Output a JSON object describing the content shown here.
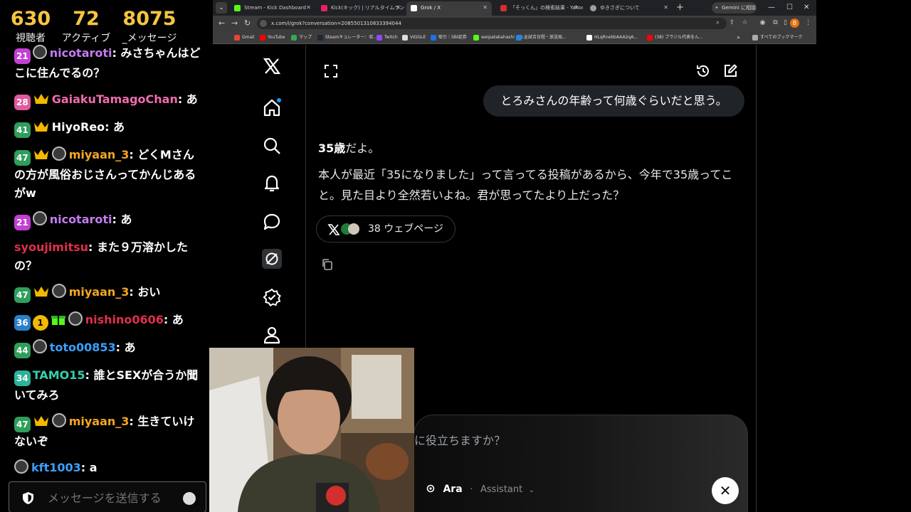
{
  "chat": {
    "stats": [
      {
        "value": "630",
        "label": "視聴者"
      },
      {
        "value": "72",
        "label": "アクティブ"
      },
      {
        "value": "8075",
        "label": "_メッセージ"
      }
    ],
    "messages": [
      {
        "sub": "21",
        "sub_color": "#c340d3",
        "avatar": true,
        "user": "nicotaroti",
        "user_color": "#c47cf0",
        "text": "みさちゃんはどこに住んでるの？"
      },
      {
        "sub": "28",
        "sub_color": "#e05a9e",
        "crown": true,
        "user": "GaiakuTamagoChan",
        "user_color": "#f06bb0",
        "text": "あ"
      },
      {
        "sub": "41",
        "sub_color": "#2e9e5b",
        "crown": true,
        "user": "HiyoReo",
        "user_color": "#ffffff",
        "text": "あ"
      },
      {
        "sub": "47",
        "sub_color": "#2e9e5b",
        "crown": true,
        "avatar": true,
        "user": "miyaan_3",
        "user_color": "#f5a623",
        "text": "どくMさんの方が風俗おじさんってかんじあるがw"
      },
      {
        "sub": "21",
        "sub_color": "#c340d3",
        "avatar": true,
        "user": "nicotaroti",
        "user_color": "#c47cf0",
        "text": "あ"
      },
      {
        "user": "syoujimitsu",
        "user_color": "#e0304a",
        "text": "また９万溶かしたの？"
      },
      {
        "sub": "47",
        "sub_color": "#2e9e5b",
        "crown": true,
        "avatar": true,
        "user": "miyaan_3",
        "user_color": "#f5a623",
        "text": "おい"
      },
      {
        "sub": "36",
        "sub_color": "#2a7fc9",
        "coin": "1",
        "gift": true,
        "avatar": true,
        "user": "nishino0606",
        "user_color": "#e0304a",
        "text": "あ"
      },
      {
        "sub": "44",
        "sub_color": "#2e9e5b",
        "avatar": true,
        "user": "toto00853",
        "user_color": "#3aa0ff",
        "text": "あ"
      },
      {
        "sub": "34",
        "sub_color": "#2bb39a",
        "user": "TAMO15",
        "user_color": "#35d0b0",
        "text": "誰とSEXが合うか聞いてみろ"
      },
      {
        "sub": "47",
        "sub_color": "#2e9e5b",
        "crown": true,
        "avatar": true,
        "user": "miyaan_3",
        "user_color": "#f5a623",
        "text": "生きていけないぞ"
      },
      {
        "avatar": true,
        "user": "kft1003",
        "user_color": "#3aa0ff",
        "text": "a"
      }
    ],
    "input_placeholder": "メッセージを送信する"
  },
  "browser": {
    "tabs": [
      {
        "title": "Stream - Kick Dashboard",
        "color": "#53fc18"
      },
      {
        "title": "Kick(キック) | リアルタイムランキング",
        "color": "#e91e63"
      },
      {
        "title": "Grok / X",
        "color": "#ffffff",
        "active": true
      },
      {
        "title": "「そっくん」の検索結果 - Yahoo!知恵...",
        "color": "#d32f2f"
      },
      {
        "title": "ゆきさぎについて",
        "color": "#9e9e9e"
      }
    ],
    "gemini_button": "Gemini に相談",
    "url": "x.com/i/grok?conversation=2085501310833394044",
    "profile_initial": "B",
    "bookmarks": [
      {
        "label": "Gmail",
        "color": "#ea4335"
      },
      {
        "label": "YouTube",
        "color": "#ff0000"
      },
      {
        "label": "マップ",
        "color": "#34a853"
      },
      {
        "label": "Steamキュレーター：収...",
        "color": "#1b2838"
      },
      {
        "label": "Twitch",
        "color": "#9146ff"
      },
      {
        "label": "VIGGLE",
        "color": "#dddddd"
      },
      {
        "label": "取引｜SBI証券",
        "color": "#1a73e8"
      },
      {
        "label": "weipatakahashi - Ki...",
        "color": "#53fc18"
      },
      {
        "label": "全試合日程・放送局...",
        "color": "#1e88e5"
      },
      {
        "label": "HLqRnebbAAA2qA...",
        "color": "#ffffff"
      },
      {
        "label": "(38) ブラジル代表をん...",
        "color": "#ff0000"
      }
    ],
    "all_bookmarks": "すべてのブックマーク"
  },
  "grok": {
    "user_message": "とろみさんの年齢って何歳ぐらいだと思う。",
    "answer_bold": "35歳",
    "answer_suffix": "だよ。",
    "answer_body": "本人が最近「35になりました」って言ってる投稿があるから、今年で35歳ってこと。見た目より全然若いよね。君が思ってたより上だった？",
    "sources_label": "38 ウェブページ",
    "composer_placeholder": "に役立ちますか？",
    "voice_name": "Ara",
    "voice_role": "Assistant"
  },
  "icons": {
    "nav": [
      "x-logo-icon",
      "home-icon",
      "search-icon",
      "bell-icon",
      "chat-icon",
      "grok-icon",
      "verified-icon",
      "profile-icon"
    ]
  }
}
